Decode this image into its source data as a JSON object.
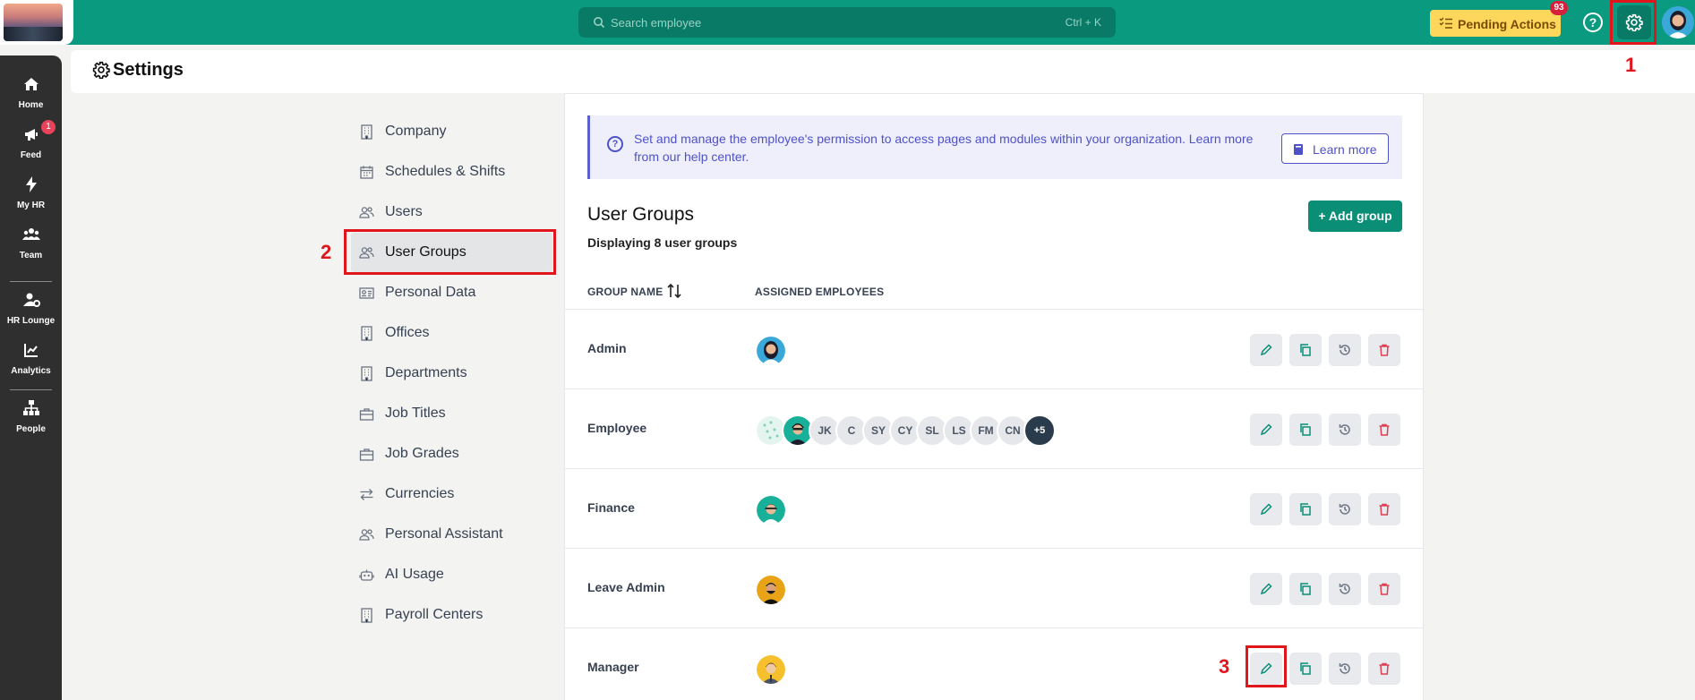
{
  "topbar": {
    "search_placeholder": "Search employee",
    "search_shortcut": "Ctrl + K",
    "pending_label": "Pending Actions",
    "pending_count": "93",
    "help_glyph": "?",
    "brand_color": "#0a9a7f"
  },
  "rail": {
    "items": [
      {
        "label": "Home",
        "icon": "home-icon"
      },
      {
        "label": "Feed",
        "icon": "megaphone-icon",
        "badge": "1"
      },
      {
        "label": "My HR",
        "icon": "bolt-icon"
      },
      {
        "label": "Team",
        "icon": "team-icon"
      },
      {
        "label": "HR Lounge",
        "icon": "user-gear-icon"
      },
      {
        "label": "Analytics",
        "icon": "chart-icon"
      },
      {
        "label": "People",
        "icon": "org-chart-icon"
      }
    ]
  },
  "header": {
    "title": "Settings"
  },
  "menu": {
    "items": [
      {
        "label": "Company",
        "icon": "building-icon"
      },
      {
        "label": "Schedules & Shifts",
        "icon": "calendar-icon"
      },
      {
        "label": "Users",
        "icon": "users-icon"
      },
      {
        "label": "User Groups",
        "icon": "users-icon",
        "active": true
      },
      {
        "label": "Personal Data",
        "icon": "id-card-icon"
      },
      {
        "label": "Offices",
        "icon": "building-icon"
      },
      {
        "label": "Departments",
        "icon": "building-icon"
      },
      {
        "label": "Job Titles",
        "icon": "briefcase-icon"
      },
      {
        "label": "Job Grades",
        "icon": "briefcase-icon"
      },
      {
        "label": "Currencies",
        "icon": "exchange-icon"
      },
      {
        "label": "Personal Assistant",
        "icon": "users-icon"
      },
      {
        "label": "AI Usage",
        "icon": "robot-icon"
      },
      {
        "label": "Payroll Centers",
        "icon": "building-icon"
      }
    ]
  },
  "banner": {
    "text": "Set and manage the employee's permission to access pages and modules within your organization. Learn more from our help center.",
    "button_label": "Learn more"
  },
  "user_groups": {
    "title": "User Groups",
    "subtitle": "Displaying 8 user groups",
    "add_label": "+ Add group",
    "col_name": "GROUP NAME",
    "col_assigned": "ASSIGNED EMPLOYEES",
    "rows": [
      {
        "name": "Admin"
      },
      {
        "name": "Employee",
        "initials": [
          "JK",
          "C",
          "SY",
          "CY",
          "SL",
          "LS",
          "FM",
          "CN"
        ],
        "more": "+5"
      },
      {
        "name": "Finance"
      },
      {
        "name": "Leave Admin"
      },
      {
        "name": "Manager"
      }
    ]
  },
  "annotations": {
    "one": "1",
    "two": "2",
    "three": "3",
    "color": "#e0161c"
  }
}
